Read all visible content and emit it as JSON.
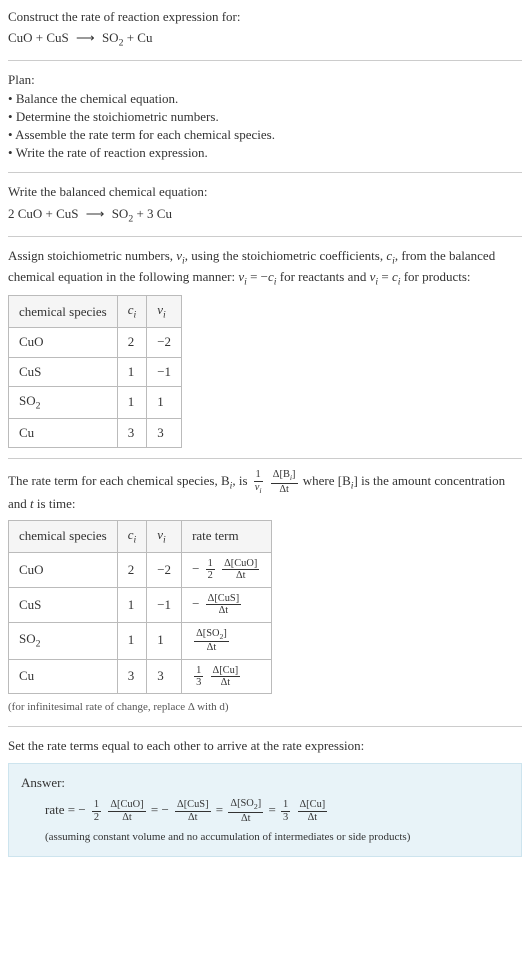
{
  "prompt": {
    "title": "Construct the rate of reaction expression for:",
    "equation_lhs_1": "CuO + CuS",
    "arrow": "⟶",
    "equation_rhs_1": "SO",
    "equation_rhs_1_sub": "2",
    "equation_rhs_1_tail": " + Cu"
  },
  "plan": {
    "heading": "Plan:",
    "items": [
      "Balance the chemical equation.",
      "Determine the stoichiometric numbers.",
      "Assemble the rate term for each chemical species.",
      "Write the rate of reaction expression."
    ]
  },
  "balanced": {
    "heading": "Write the balanced chemical equation:",
    "lhs": "2 CuO + CuS",
    "arrow": "⟶",
    "rhs_a": "SO",
    "rhs_a_sub": "2",
    "rhs_tail": " + 3 Cu"
  },
  "stoich_text": {
    "pre": "Assign stoichiometric numbers, ",
    "nu": "ν",
    "i": "i",
    "mid1": ", using the stoichiometric coefficients, ",
    "c": "c",
    "mid2": ", from the balanced chemical equation in the following manner: ",
    "reactants": " = −",
    "reactants_tail": " for reactants and ",
    "products": " = ",
    "products_tail": " for products:"
  },
  "stoich_table": {
    "headers": [
      "chemical species",
      "c_i",
      "ν_i"
    ],
    "rows": [
      {
        "species": "CuO",
        "c": "2",
        "nu": "−2"
      },
      {
        "species": "CuS",
        "c": "1",
        "nu": "−1"
      },
      {
        "species": "SO2",
        "species_base": "SO",
        "species_sub": "2",
        "c": "1",
        "nu": "1"
      },
      {
        "species": "Cu",
        "c": "3",
        "nu": "3"
      }
    ]
  },
  "rate_term_text": {
    "pre": "The rate term for each chemical species, B",
    "mid1": ", is ",
    "frac1_num": "1",
    "frac1_den_a": "ν",
    "frac2_num": "Δ[B",
    "frac2_num_tail": "]",
    "frac2_den": "Δt",
    "mid2": " where [B",
    "mid3": "] is the amount concentration and ",
    "t": "t",
    "tail": " is time:"
  },
  "rate_table": {
    "headers": [
      "chemical species",
      "c_i",
      "ν_i",
      "rate term"
    ],
    "rows": [
      {
        "species": "CuO",
        "c": "2",
        "nu": "−2",
        "rt_prefix": "−",
        "rt_coef_num": "1",
        "rt_coef_den": "2",
        "rt_delta_num": "Δ[CuO]",
        "rt_delta_den": "Δt"
      },
      {
        "species": "CuS",
        "c": "1",
        "nu": "−1",
        "rt_prefix": "−",
        "rt_coef_num": "",
        "rt_coef_den": "",
        "rt_delta_num": "Δ[CuS]",
        "rt_delta_den": "Δt"
      },
      {
        "species_base": "SO",
        "species_sub": "2",
        "c": "1",
        "nu": "1",
        "rt_prefix": "",
        "rt_coef_num": "",
        "rt_coef_den": "",
        "rt_delta_num": "Δ[SO2]",
        "rt_delta_den": "Δt",
        "rt_delta_num_base": "Δ[SO",
        "rt_delta_num_sub": "2",
        "rt_delta_num_tail": "]"
      },
      {
        "species": "Cu",
        "c": "3",
        "nu": "3",
        "rt_prefix": "",
        "rt_coef_num": "1",
        "rt_coef_den": "3",
        "rt_delta_num": "Δ[Cu]",
        "rt_delta_den": "Δt"
      }
    ],
    "note": "(for infinitesimal rate of change, replace Δ with d)"
  },
  "final": {
    "heading": "Set the rate terms equal to each other to arrive at the rate expression:",
    "answer_label": "Answer:",
    "rate_word": "rate = ",
    "neg": "−",
    "half_num": "1",
    "half_den": "2",
    "d_cuo_num": "Δ[CuO]",
    "d_cuo_den": "Δt",
    "eq": " = ",
    "d_cus_num": "Δ[CuS]",
    "d_cus_den": "Δt",
    "d_so2_num_base": "Δ[SO",
    "d_so2_num_sub": "2",
    "d_so2_num_tail": "]",
    "d_so2_den": "Δt",
    "third_num": "1",
    "third_den": "3",
    "d_cu_num": "Δ[Cu]",
    "d_cu_den": "Δt",
    "assume": "(assuming constant volume and no accumulation of intermediates or side products)"
  }
}
